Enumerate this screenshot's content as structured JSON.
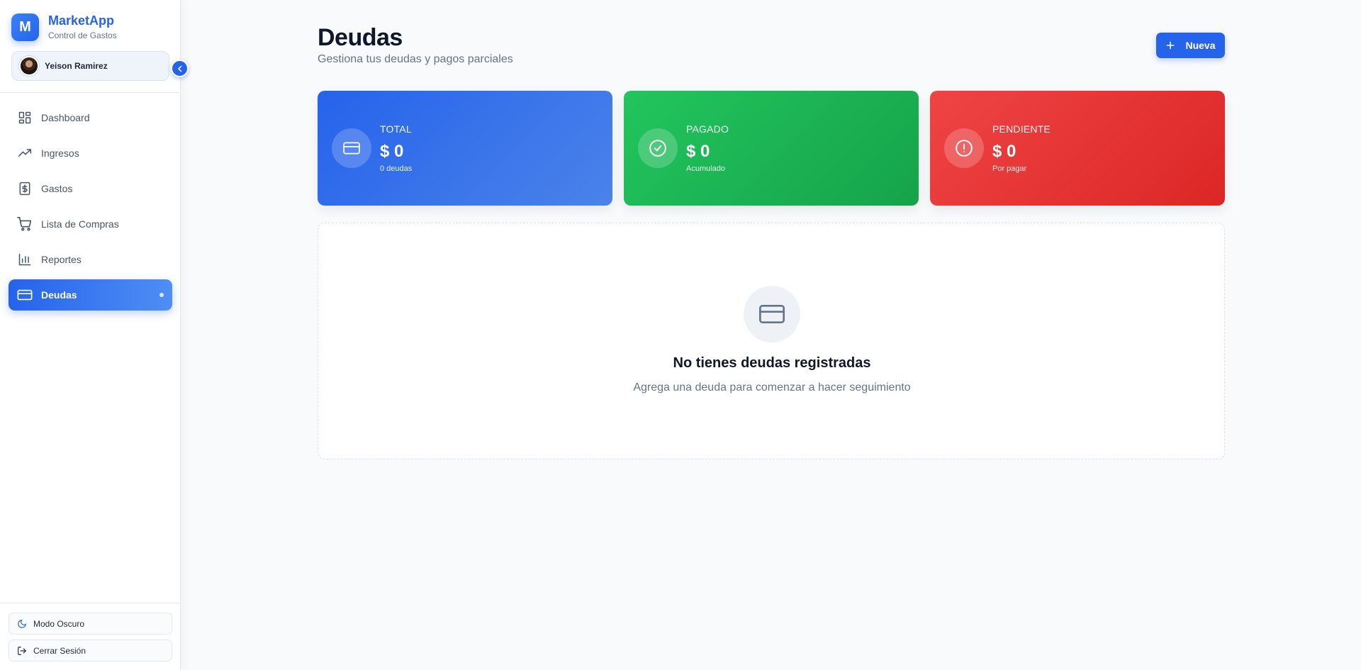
{
  "brand": {
    "logo_letter": "M",
    "name": "MarketApp",
    "subtitle": "Control de Gastos"
  },
  "user": {
    "name": "Yeison Ramirez"
  },
  "nav": [
    {
      "label": "Dashboard",
      "icon": "grid-icon"
    },
    {
      "label": "Ingresos",
      "icon": "trending-up-icon"
    },
    {
      "label": "Gastos",
      "icon": "dollar-receipt-icon"
    },
    {
      "label": "Lista de Compras",
      "icon": "cart-icon"
    },
    {
      "label": "Reportes",
      "icon": "bar-chart-icon"
    },
    {
      "label": "Deudas",
      "icon": "credit-card-icon",
      "active": true
    }
  ],
  "footer": {
    "dark_mode_label": "Modo Oscuro",
    "logout_label": "Cerrar Sesión"
  },
  "header": {
    "title": "Deudas",
    "subtitle": "Gestiona tus deudas y pagos parciales",
    "new_button_label": "Nueva"
  },
  "stats": [
    {
      "label": "TOTAL",
      "value": "$ 0",
      "note": "0 deudas",
      "icon": "credit-card-icon",
      "color": "#2563eb"
    },
    {
      "label": "PAGADO",
      "value": "$ 0",
      "note": "Acumulado",
      "icon": "check-circle-icon",
      "color": "#22c55e"
    },
    {
      "label": "PENDIENTE",
      "value": "$ 0",
      "note": "Por pagar",
      "icon": "alert-circle-icon",
      "color": "#ef4444"
    }
  ],
  "empty_state": {
    "title": "No tienes deudas registradas",
    "subtitle": "Agrega una deuda para comenzar a hacer seguimiento",
    "icon": "credit-card-icon"
  },
  "colors": {
    "accent": "#2563eb",
    "background": "#f8fafc"
  }
}
